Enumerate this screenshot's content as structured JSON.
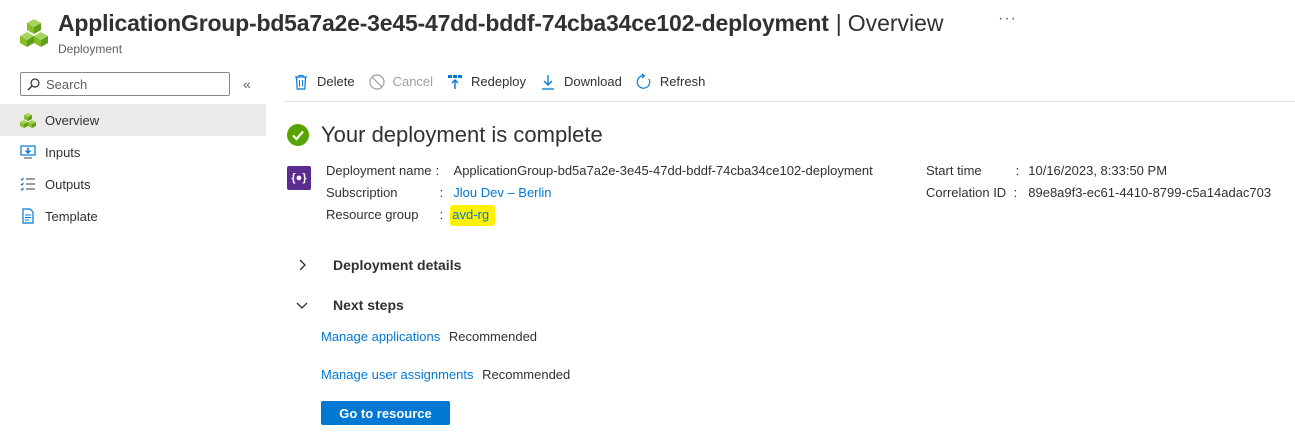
{
  "header": {
    "title": "ApplicationGroup-bd5a7a2e-3e45-47dd-bddf-74cba34ce102-deployment",
    "separator": "|",
    "section": "Overview",
    "more": "···",
    "subtitle": "Deployment",
    "logo_icon": "cubes-icon"
  },
  "sidebar": {
    "search": {
      "placeholder": "Search",
      "value": ""
    },
    "collapse_label": "«",
    "items": [
      {
        "label": "Overview",
        "icon": "cubes-icon",
        "active": true
      },
      {
        "label": "Inputs",
        "icon": "inputs-icon",
        "active": false
      },
      {
        "label": "Outputs",
        "icon": "outputs-icon",
        "active": false
      },
      {
        "label": "Template",
        "icon": "template-icon",
        "active": false
      }
    ]
  },
  "toolbar": {
    "delete_label": "Delete",
    "cancel_label": "Cancel",
    "redeploy_label": "Redeploy",
    "download_label": "Download",
    "refresh_label": "Refresh"
  },
  "main": {
    "status_title": "Your deployment is complete",
    "resource_icon_text": "{●}",
    "details": {
      "deployment_name_label": "Deployment name",
      "deployment_name_value": "ApplicationGroup-bd5a7a2e-3e45-47dd-bddf-74cba34ce102-deployment",
      "subscription_label": "Subscription",
      "subscription_value": "Jlou Dev – Berlin",
      "resource_group_label": "Resource group",
      "resource_group_value": "avd-rg",
      "start_time_label": "Start time",
      "start_time_value": "10/16/2023, 8:33:50 PM",
      "correlation_id_label": "Correlation ID",
      "correlation_id_value": "89e8a9f3-ec61-4410-8799-c5a14adac703",
      "colon": ":"
    },
    "deployment_details_label": "Deployment details",
    "next_steps_label": "Next steps",
    "next_steps": [
      {
        "link": "Manage applications",
        "tag": "Recommended"
      },
      {
        "link": "Manage user assignments",
        "tag": "Recommended"
      }
    ],
    "go_button_label": "Go to resource"
  },
  "colors": {
    "accent": "#0078d4",
    "success": "#57a300",
    "highlight": "#fff100",
    "resource_icon_bg": "#5c2d91"
  }
}
